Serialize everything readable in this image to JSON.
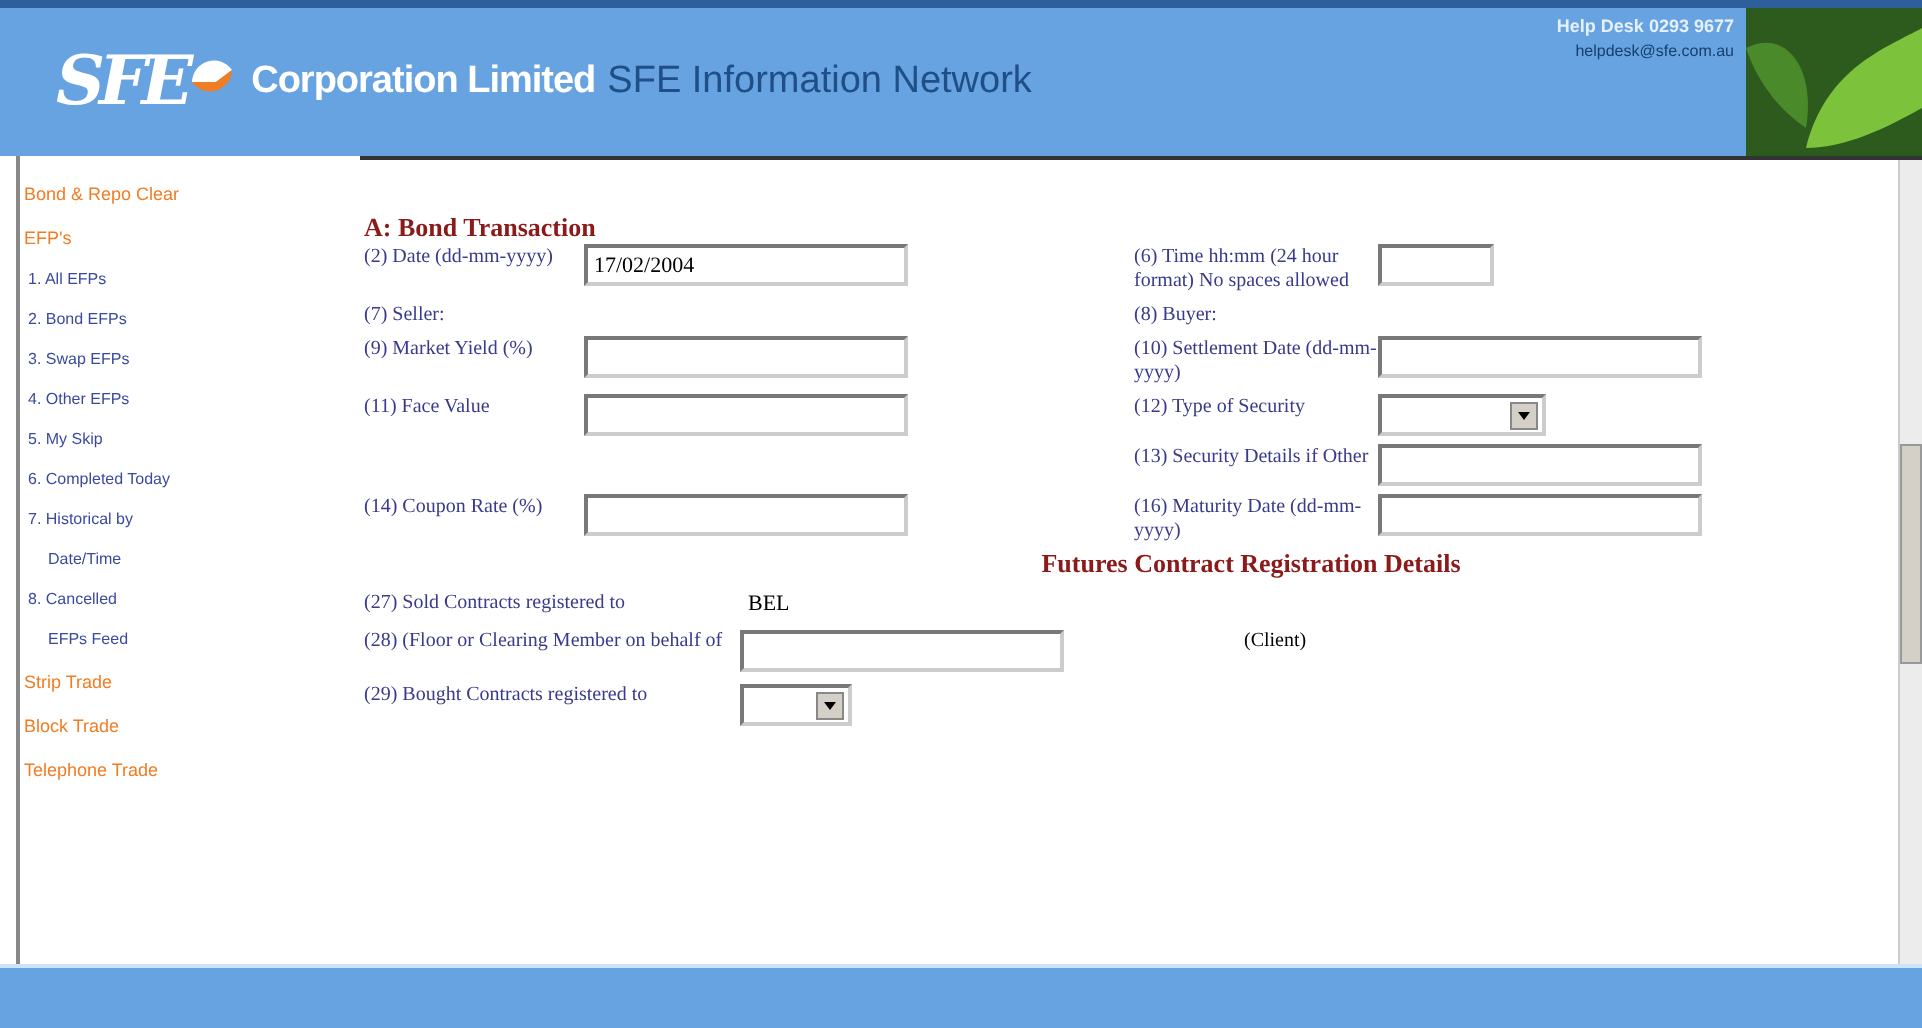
{
  "header": {
    "logo_text": "SFE",
    "title": "Corporation Limited",
    "subtitle": "SFE Information Network",
    "help_desk": "Help Desk 0293 9677",
    "help_email": "helpdesk@sfe.com.au"
  },
  "sidebar": {
    "items": [
      {
        "kind": "section",
        "lines": [
          "Bond & Repo Clear"
        ]
      },
      {
        "kind": "section",
        "lines": [
          "EFP's"
        ]
      },
      {
        "kind": "link",
        "lines": [
          "1. All EFPs"
        ]
      },
      {
        "kind": "link",
        "lines": [
          "2. Bond EFPs"
        ]
      },
      {
        "kind": "link",
        "lines": [
          "3. Swap EFPs"
        ]
      },
      {
        "kind": "link",
        "lines": [
          "4. Other EFPs"
        ]
      },
      {
        "kind": "link",
        "lines": [
          "5. My Skip"
        ]
      },
      {
        "kind": "link",
        "lines": [
          "6. Completed Today"
        ]
      },
      {
        "kind": "link",
        "lines": [
          "7. Historical by",
          "Date/Time"
        ]
      },
      {
        "kind": "link",
        "lines": [
          "8. Cancelled",
          "EFPs Feed"
        ]
      },
      {
        "kind": "section",
        "lines": [
          "Strip Trade"
        ]
      },
      {
        "kind": "section",
        "lines": [
          "Block Trade"
        ]
      },
      {
        "kind": "section",
        "lines": [
          "Telephone Trade"
        ]
      }
    ]
  },
  "form": {
    "title": "A: Bond Transaction",
    "rows": [
      {
        "left": {
          "label": "(2) Date (dd-mm-yyyy)",
          "control": {
            "kind": "text",
            "value": "17/02/2004"
          }
        },
        "right": {
          "label": "(6) Time hh:mm (24 hour format) No spaces allowed",
          "control": {
            "kind": "short-text"
          }
        }
      },
      {
        "left": {
          "label": "(7) Seller:"
        },
        "right": {
          "label": "(8) Buyer:"
        }
      },
      {
        "left": {
          "label": "(9) Market Yield (%)",
          "control": {
            "kind": "text"
          }
        },
        "right": {
          "label": "(10) Settlement Date (dd-mm-yyyy)",
          "control": {
            "kind": "text"
          }
        }
      },
      {
        "left": {
          "label": "(11) Face Value",
          "control": {
            "kind": "text"
          }
        },
        "right": {
          "label": "(12) Type of Security",
          "control": {
            "kind": "select"
          }
        }
      },
      {
        "right": {
          "label": "(13) Security Details if Other",
          "control": {
            "kind": "text"
          }
        }
      },
      {
        "left": {
          "label": "(14) Coupon Rate (%)",
          "control": {
            "kind": "text"
          }
        },
        "right": {
          "label": "(16) Maturity Date (dd-mm-yyyy)",
          "control": {
            "kind": "text"
          }
        }
      }
    ]
  },
  "futures": {
    "title": "Futures Contract Registration Details",
    "rows": [
      {
        "label": "(27) Sold Contracts registered to",
        "control": {
          "kind": "static",
          "value": "BEL"
        }
      },
      {
        "label": "(28) (Floor or Clearing Member on behalf of",
        "control": {
          "kind": "text"
        },
        "note": "(Client)"
      },
      {
        "label": "(29) Bought Contracts registered to",
        "control": {
          "kind": "select"
        }
      }
    ]
  }
}
